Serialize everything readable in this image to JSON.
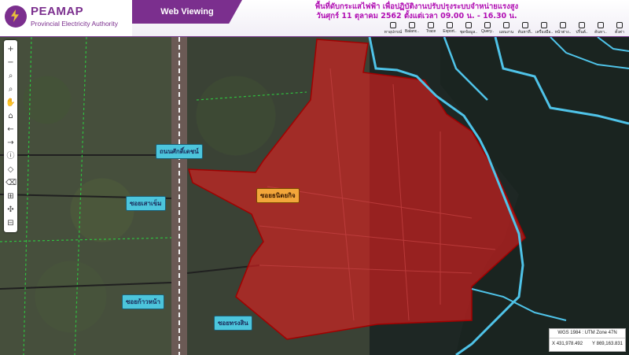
{
  "app": {
    "logo_title": "PEAMAP",
    "logo_subtitle": "Provincial Electricity Authority",
    "mode": "Web Viewing"
  },
  "announcement": {
    "line1": "พื้นที่ดับกระแสไฟฟ้า เพื่อปฏิบัติงานปรับปรุงระบบจำหน่ายแรงสูง",
    "line2": "วันศุกร์ 11 ตุลาคม 2562 ตั้งแต่เวลา 09.00 น. - 16.30 น."
  },
  "toolbar": [
    {
      "label": "หาอุปกรณ์",
      "icon": "search-device-icon"
    },
    {
      "label": "Balanc..",
      "icon": "balance-icon"
    },
    {
      "label": "Trace",
      "icon": "trace-icon"
    },
    {
      "label": "Export..",
      "icon": "export-icon"
    },
    {
      "label": "ชุดข้อมูล..",
      "icon": "dataset-icon"
    },
    {
      "label": "Query..",
      "icon": "query-icon"
    },
    {
      "label": "แผนงาน",
      "icon": "plan-icon"
    },
    {
      "label": "ค้นหาที่..",
      "icon": "find-place-icon"
    },
    {
      "label": "เครื่องมือ..",
      "icon": "tools-icon"
    },
    {
      "label": "หน้าต่าง..",
      "icon": "window-icon"
    },
    {
      "label": "ปริ้นต์..",
      "icon": "print-icon"
    },
    {
      "label": "ค้นหา..",
      "icon": "search-icon"
    },
    {
      "label": "ตั้งค่า",
      "icon": "settings-icon"
    }
  ],
  "sidebar": [
    {
      "glyph": "+",
      "icon": "zoom-in-icon"
    },
    {
      "glyph": "−",
      "icon": "zoom-out-icon"
    },
    {
      "glyph": "⌕",
      "icon": "zoom-box-icon"
    },
    {
      "glyph": "⌕",
      "icon": "zoom-out-box-icon"
    },
    {
      "glyph": "✋",
      "icon": "pan-icon"
    },
    {
      "glyph": "⌂",
      "icon": "full-extent-icon"
    },
    {
      "glyph": "←",
      "icon": "previous-extent-icon"
    },
    {
      "glyph": "→",
      "icon": "next-extent-icon"
    },
    {
      "glyph": "ⓘ",
      "icon": "identify-icon"
    },
    {
      "glyph": "◇",
      "icon": "select-icon"
    },
    {
      "glyph": "⌫",
      "icon": "clear-icon"
    },
    {
      "glyph": "⊞",
      "icon": "measure-icon"
    },
    {
      "glyph": "✣",
      "icon": "locate-icon"
    },
    {
      "glyph": "⊟",
      "icon": "layer-icon"
    }
  ],
  "map_labels": {
    "road1": "ถนนศักดิ์เดชน์",
    "road2": "ซอยเสาเข็ม",
    "road3": "ซอยก้าวหน้า",
    "road4": "ซอยทรงสิน",
    "outage_area": "ซอยธนิตยกิจ"
  },
  "coords": {
    "system": "WGS 1984 : UTM Zone 47N",
    "x_label": "X",
    "x_value": "431,978.492",
    "y_label": "Y",
    "y_value": "869,163.831"
  },
  "colors": {
    "brand": "#7b2f8e",
    "outage_fill": "#e21e1e",
    "water": "#4fc3e8",
    "label_blue": "#4cc5dc",
    "label_orange": "#f2a63a"
  }
}
